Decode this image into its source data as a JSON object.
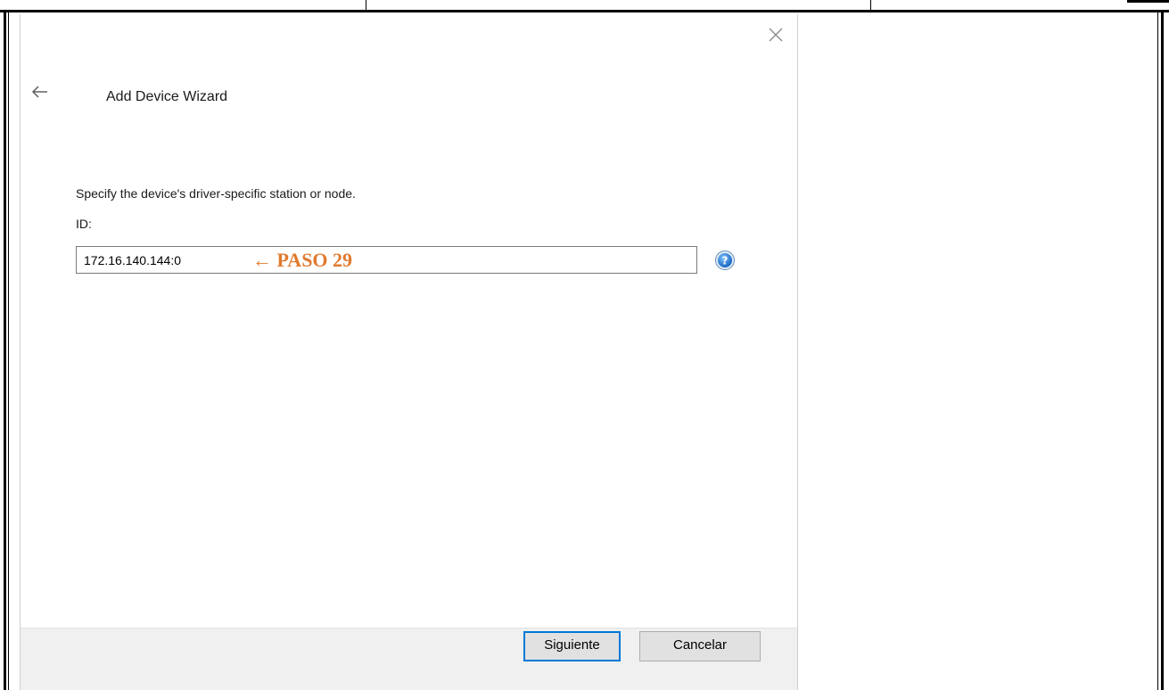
{
  "dialog": {
    "title": "Add Device Wizard",
    "instruction": "Specify the device's driver-specific station or node.",
    "id_label": "ID:",
    "id_value": "172.16.140.144:0",
    "annotation": "← PASO 29",
    "annotation_color": "#e07a2e",
    "close_icon": "close-icon",
    "back_icon": "back-arrow-icon",
    "help_icon": "help-icon"
  },
  "footer": {
    "next_label": "Siguiente",
    "cancel_label": "Cancelar",
    "accent_color": "#0078d7"
  }
}
